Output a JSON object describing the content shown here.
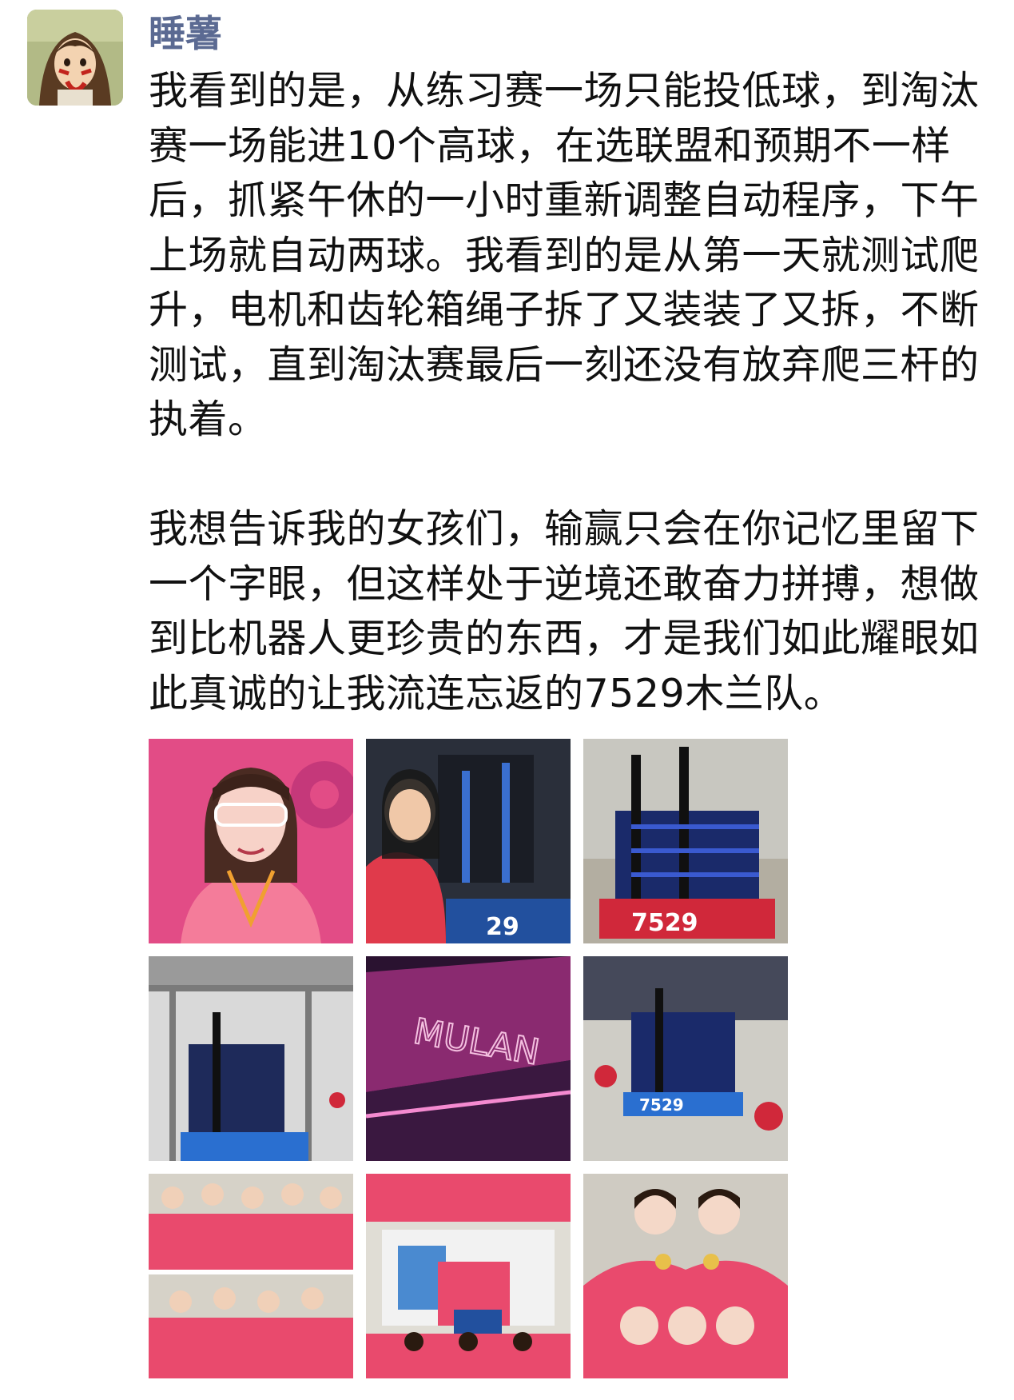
{
  "post": {
    "author": "睡薯",
    "text": "我看到的是，从练习赛一场只能投低球，到淘汰赛一场能进10个高球，在选联盟和预期不一样后，抓紧午休的一小时重新调整自动程序，下午上场就自动两球。我看到的是从第一天就测试爬升，电机和齿轮箱绳子拆了又装装了又拆，不断测试，直到淘汰赛最后一刻还没有放弃爬三杆的执着。\n\n我想告诉我的女孩们，输赢只会在你记忆里留下一个字眼，但这样处于逆境还敢奋力拼搏，想做到比机器人更珍贵的东西，才是我们如此耀眼如此真诚的让我流连忘返的7529木兰队。"
  },
  "photos": [
    {
      "id": "photo-1",
      "subject": "girl with safety glasses, pink background",
      "overlay_text": ""
    },
    {
      "id": "photo-2",
      "subject": "girl working on robot",
      "overlay_text": "29"
    },
    {
      "id": "photo-3",
      "subject": "blue robot on red base",
      "overlay_text": "7529"
    },
    {
      "id": "photo-4",
      "subject": "robot in arena truss",
      "overlay_text": ""
    },
    {
      "id": "photo-5",
      "subject": "pink neon sign",
      "overlay_text": "MULAN"
    },
    {
      "id": "photo-6",
      "subject": "robot on field with red balls",
      "overlay_text": "7529"
    },
    {
      "id": "photo-7",
      "subject": "team group photos",
      "overlay_text": ""
    },
    {
      "id": "photo-8",
      "subject": "team collage with robot",
      "overlay_text": ""
    },
    {
      "id": "photo-9",
      "subject": "girls with medals",
      "overlay_text": ""
    }
  ],
  "colors": {
    "author_name": "#5b6a92",
    "text": "#111111",
    "team_pink": "#e94a6d"
  }
}
